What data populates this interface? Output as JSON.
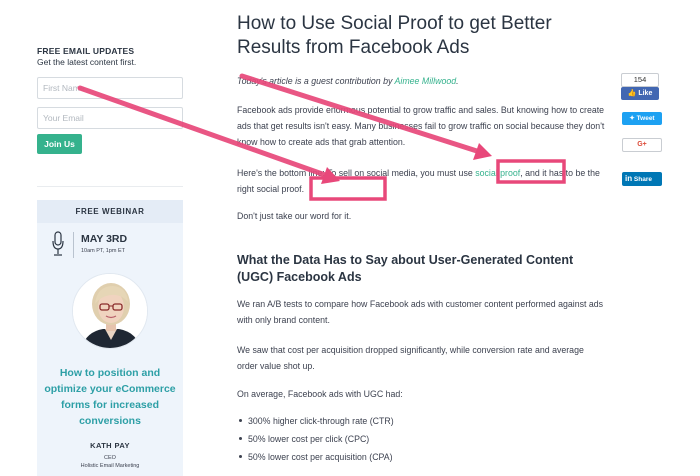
{
  "sidebar": {
    "signup": {
      "heading": "FREE EMAIL UPDATES",
      "subtext": "Get the latest content first.",
      "first_name_placeholder": "First Name",
      "email_placeholder": "Your Email",
      "join_label": "Join Us"
    },
    "webinar": {
      "label": "FREE WEBINAR",
      "date": "MAY 3RD",
      "time": "10am PT, 1pm ET",
      "title": "How to position and optimize your eCommerce forms for increased conversions",
      "speaker_name": "KATH PAY",
      "speaker_role": "CEO",
      "speaker_company": "Holistic Email Marketing"
    }
  },
  "article": {
    "title": "How to Use Social Proof to get Better Results from Facebook Ads",
    "intro_prefix": "Today's article is a guest contribution by ",
    "author": "Aimee Millwood",
    "intro_suffix": ".",
    "p1": "Facebook ads provide enormous potential to grow traffic and sales. But knowing how to create ads that get results isn't easy. Many businesses fail to grow traffic on social because they don't know how to create ads that grab attention.",
    "p2_before": "Here's the bottom line: To sell on social media, you must use ",
    "p2_link": "social proof",
    "p2_mid": ", and it has to be the right ",
    "p2_emph": "social proof",
    "p2_after": ".",
    "p3": "Don't just take our word for it.",
    "section_heading": "What the Data Has to Say about User-Generated Content (UGC) Facebook Ads",
    "p4": "We ran A/B tests to compare how Facebook ads with customer content performed against ads with only brand content.",
    "p5": "We saw that cost per acquisition dropped significantly, while conversion rate and average order value shot up.",
    "p6": "On average, Facebook ads with UGC had:",
    "bullets": [
      "300% higher click-through rate (CTR)",
      "50% lower cost per click (CPC)",
      "50% lower cost per acquisition (CPA)"
    ]
  },
  "share": {
    "like_count": "154",
    "like_label": "Like",
    "tweet_label": "Tweet",
    "gplus_label": "G+",
    "share_label": "Share"
  },
  "colors": {
    "accent_green": "#35b28d",
    "webinar_teal": "#2d9fa6",
    "annotation_pink": "#e8487a",
    "facebook_blue": "#4267b2",
    "twitter_blue": "#1da1f2",
    "linkedin_blue": "#0077b5"
  },
  "icons": [
    "microphone-icon",
    "facebook-thumb-icon",
    "twitter-bird-icon",
    "linkedin-logo-icon"
  ]
}
